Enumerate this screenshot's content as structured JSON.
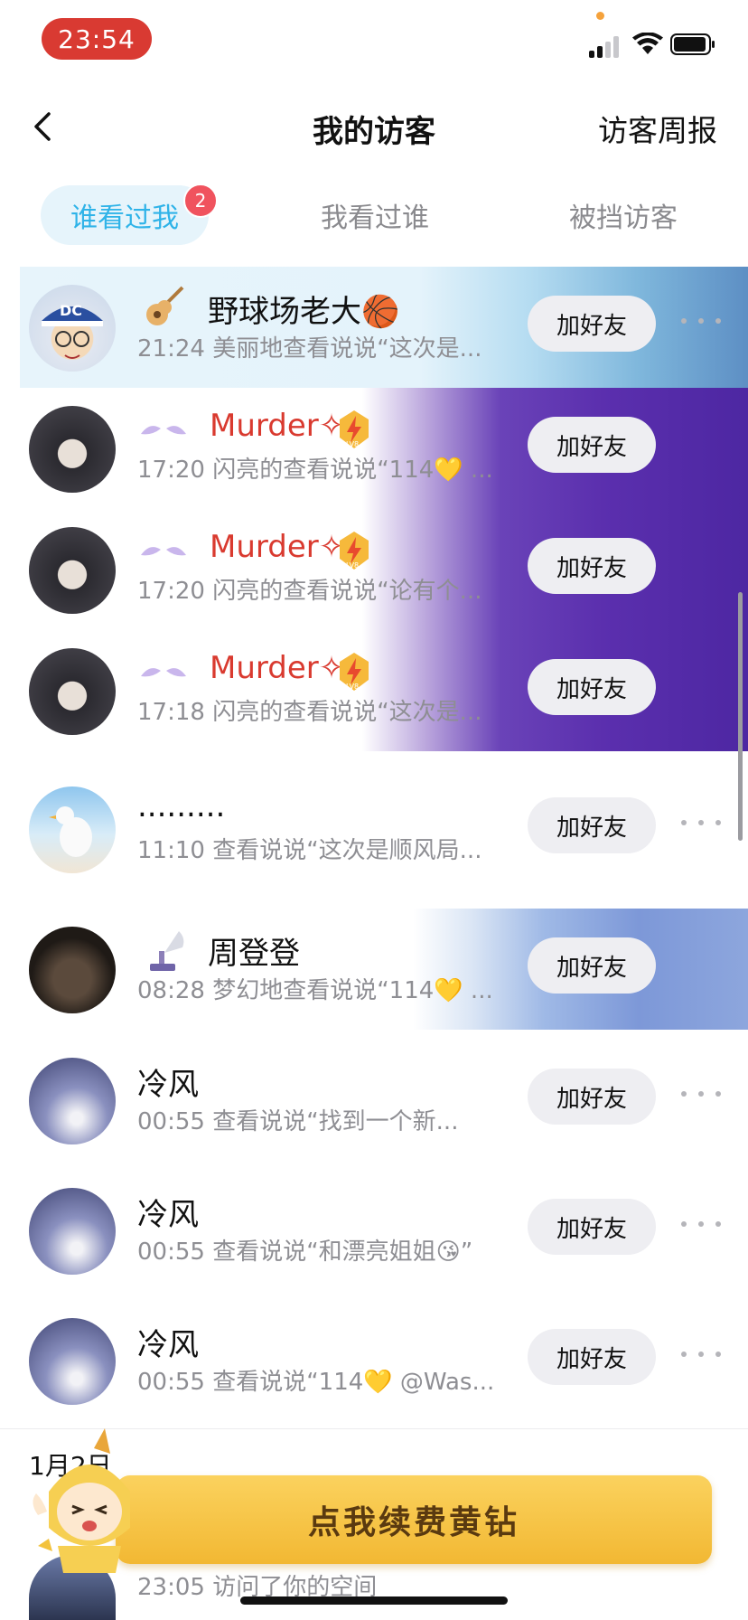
{
  "status_bar": {
    "time": "23:54"
  },
  "nav": {
    "title": "我的访客",
    "right_action": "访客周报"
  },
  "tabs": [
    {
      "label": "谁看过我",
      "badge": "2",
      "active": true
    },
    {
      "label": "我看过谁"
    },
    {
      "label": "被挡访客"
    }
  ],
  "visitors": [
    {
      "name": "野球场老大🏀",
      "subtitle": "21:24 美丽地查看说说“这次是...",
      "add_label": "加好友",
      "background": "guitar"
    },
    {
      "name": "Murder✧",
      "subtitle": "17:20 闪亮的查看说说“114💛 ...",
      "add_label": "加好友",
      "background": "starry"
    },
    {
      "name": "Murder✧",
      "subtitle": "17:20 闪亮的查看说说“论有个...",
      "add_label": "加好友",
      "background": "starry"
    },
    {
      "name": "Murder✧",
      "subtitle": "17:18 闪亮的查看说说“这次是...",
      "add_label": "加好友",
      "background": "starry"
    },
    {
      "name": ".........",
      "subtitle": "11:10 查看说说“这次是顺风局...",
      "add_label": "加好友",
      "background": "none"
    },
    {
      "name": "周登登",
      "subtitle": "08:28 梦幻地查看说说“114💛 ...",
      "add_label": "加好友",
      "background": "anime"
    },
    {
      "name": "冷风",
      "subtitle": "00:55 查看说说“找到一个新...",
      "add_label": "加好友",
      "background": "none"
    },
    {
      "name": "冷风",
      "subtitle": "00:55 查看说说“和漂亮姐姐😘”",
      "add_label": "加好友",
      "background": "none"
    },
    {
      "name": "冷风",
      "subtitle": "00:55 查看说说“114💛 @Was...",
      "add_label": "加好友",
      "background": "none"
    }
  ],
  "vip_badge": "LV8",
  "section_date": "1月2日",
  "renew_button": "点我续费黄钻",
  "last_visit": "23:05 访问了你的空间",
  "colors": {
    "accent": "#2fb3e8",
    "vip_name": "#d93a2f",
    "badge": "#f0535e",
    "gold": "#f2b833"
  }
}
